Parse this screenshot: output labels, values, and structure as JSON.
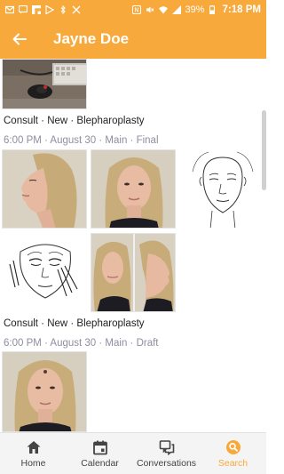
{
  "status_bar": {
    "battery": "39%",
    "time": "7:18 PM",
    "left_icons": [
      "envelope-icon",
      "chat-icon",
      "flipboard-icon",
      "play-icon",
      "bluetooth-off-icon",
      "x-icon"
    ],
    "right_icons": [
      "nfc-icon",
      "mute-icon",
      "wifi-icon",
      "signal-icon",
      "battery-icon"
    ]
  },
  "app_bar": {
    "back_icon": "arrow-left-icon",
    "title": "Jayne Doe"
  },
  "entries": [
    {
      "title": "Consult · New · Blepharoplasty",
      "meta": "6:00 PM · August 30 · Main · Final",
      "photos": [
        "desk-photo"
      ]
    },
    {
      "title": "Consult · New · Blepharoplasty",
      "meta": "6:00 PM · August 30 · Main · Draft",
      "photos": [
        "profile-left-photo",
        "front-face-photo",
        "face-sketch-front",
        "face-sketch-markings",
        "side-profile-pair-photo"
      ]
    },
    {
      "title": "",
      "meta": "",
      "photos": [
        "front-face-photo-2"
      ]
    }
  ],
  "bottom_nav": {
    "items": [
      {
        "label": "Home",
        "icon": "home-icon",
        "active": false
      },
      {
        "label": "Calendar",
        "icon": "calendar-icon",
        "active": false
      },
      {
        "label": "Conversations",
        "icon": "conversations-icon",
        "active": false
      },
      {
        "label": "Search",
        "icon": "search-icon",
        "active": true
      }
    ]
  },
  "colors": {
    "accent": "#f7a93b",
    "meta_text": "#8e8ea0",
    "nav_background": "#f4f4f4"
  }
}
